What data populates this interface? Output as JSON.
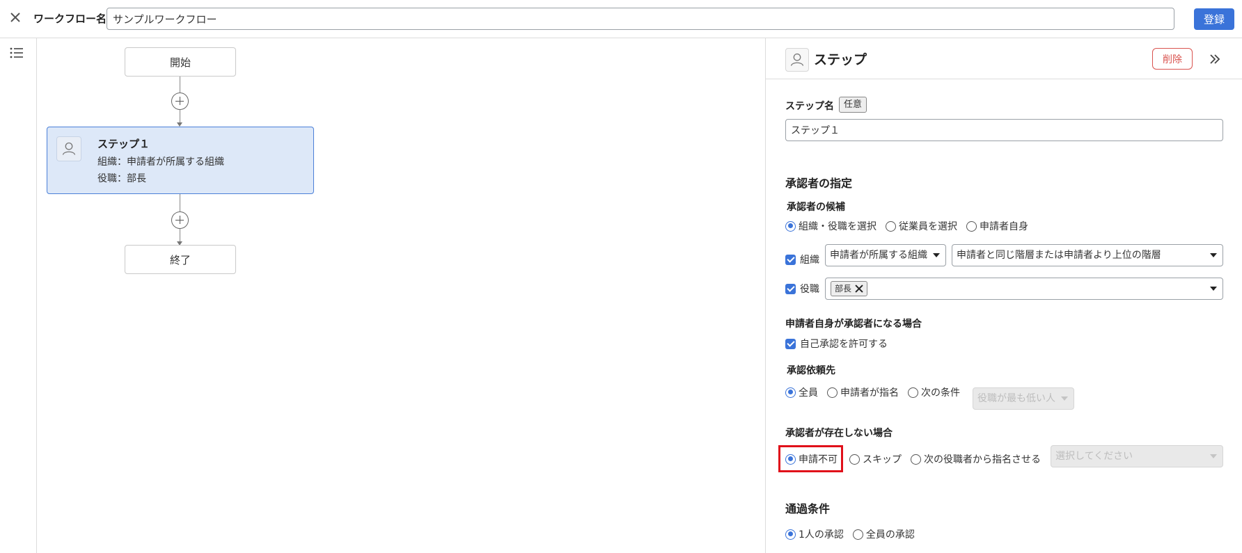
{
  "header": {
    "close_icon": "close-icon",
    "workflow_name_label": "ワークフロー名",
    "workflow_name_value": "サンプルワークフロー",
    "register_label": "登録"
  },
  "left_rail": {
    "icon": "list-icon"
  },
  "canvas": {
    "start_label": "開始",
    "end_label": "終了",
    "step": {
      "title": "ステップ１",
      "organization": "組織：申請者が所属する組織",
      "position": "役職：部長",
      "icon": "user-icon"
    },
    "add_icon": "plus-circle-icon"
  },
  "panel": {
    "title": "ステップ",
    "delete_label": "削除",
    "collapse_icon": "double-chevron-right-icon",
    "step_name": {
      "label": "ステップ名",
      "badge": "任意",
      "value": "ステップ１"
    },
    "approver_spec": {
      "heading": "承認者の指定",
      "candidates_label": "承認者の候補",
      "candidate_options": [
        "組織・役職を選択",
        "従業員を選択",
        "申請者自身"
      ],
      "candidate_selected": "組織・役職を選択",
      "org_label": "組織",
      "org_checked": true,
      "org_select_1": "申請者が所属する組織",
      "org_select_2": "申請者と同じ階層または申請者より上位の階層",
      "position_label": "役職",
      "position_checked": true,
      "position_chip": "部長"
    },
    "self_approval": {
      "label": "申請者自身が承認者になる場合",
      "checkbox_label": "自己承認を許可する",
      "checked": true
    },
    "request_target": {
      "label": "承認依頼先",
      "options": [
        "全員",
        "申請者が指名",
        "次の条件"
      ],
      "selected": "全員",
      "condition_select": "役職が最も低い人"
    },
    "no_approver": {
      "label": "承認者が存在しない場合",
      "options": [
        "申請不可",
        "スキップ",
        "次の役職者から指名させる"
      ],
      "selected": "申請不可",
      "select_placeholder": "選択してください"
    },
    "pass_condition": {
      "heading": "通過条件",
      "options": [
        "1人の承認",
        "全員の承認"
      ],
      "selected": "1人の承認"
    },
    "highlight_color": "#e0101a",
    "accent_color": "#3a73d9",
    "danger_color": "#d9534f"
  }
}
